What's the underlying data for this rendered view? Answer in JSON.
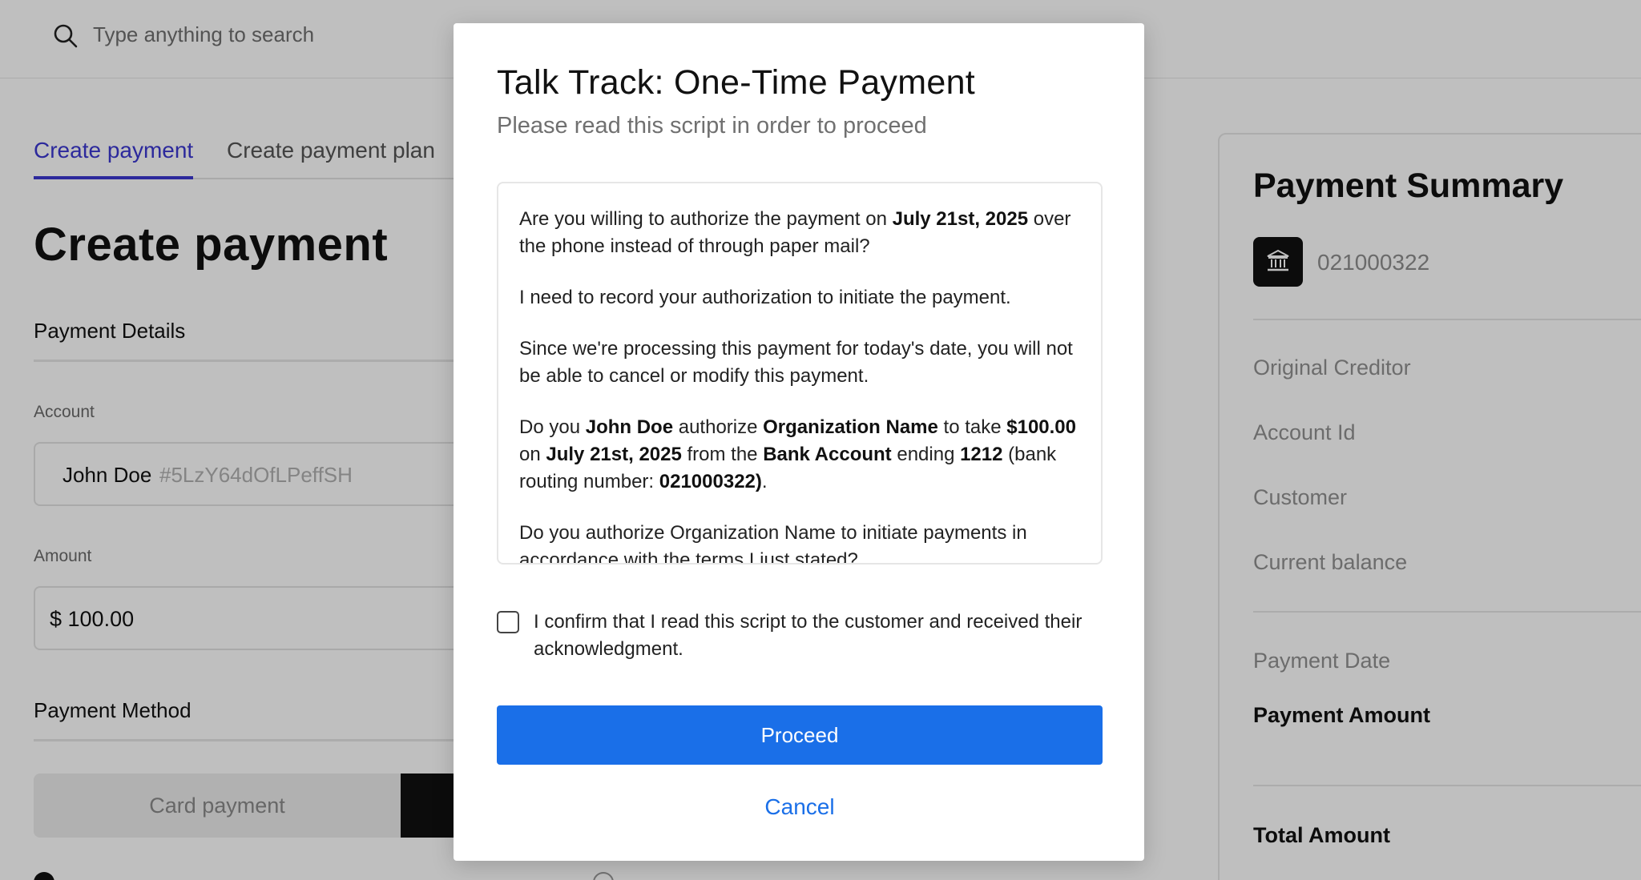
{
  "search": {
    "placeholder": "Type anything to search"
  },
  "tabs": [
    {
      "label": "Create payment",
      "active": true
    },
    {
      "label": "Create payment plan",
      "active": false
    }
  ],
  "page_title": "Create payment",
  "form": {
    "details_header": "Payment Details",
    "account_label": "Account",
    "account_name": "John Doe",
    "account_id": "#5LzY64dOfLPeffSH",
    "amount_label": "Amount",
    "amount_value": "$ 100.00",
    "method_header": "Payment Method",
    "method_card": "Card payment"
  },
  "summary": {
    "title": "Payment Summary",
    "routing_number": "021000322",
    "fields": [
      "Original Creditor",
      "Account Id",
      "Customer",
      "Current balance"
    ],
    "payment_date_label": "Payment Date",
    "payment_amount_label": "Payment Amount",
    "total_amount_label": "Total Amount"
  },
  "modal": {
    "title": "Talk Track: One-Time Payment",
    "subtitle": "Please read this script in order to proceed",
    "script": {
      "p1_a": "Are you willing to authorize the payment on ",
      "p1_date": "July 21st, 2025",
      "p1_b": " over the phone instead of through paper mail?",
      "p2": "I need to record your authorization to initiate the payment.",
      "p3": "Since we're processing this payment for today's date, you will not be able to cancel or modify this payment.",
      "p4_a": "Do you ",
      "p4_name": "John Doe",
      "p4_b": " authorize ",
      "p4_org": "Organization Name",
      "p4_c": " to take ",
      "p4_amount": "$100.00",
      "p4_d": " on ",
      "p4_date": "July 21st, 2025",
      "p4_e": " from the ",
      "p4_account": "Bank Account",
      "p4_f": " ending ",
      "p4_last4": "1212",
      "p4_g": " (bank routing number: ",
      "p4_routing": "021000322)",
      "p4_h": ".",
      "p5": "Do you authorize Organization Name to initiate payments in accordance with the terms I just stated?"
    },
    "confirm_label": "I confirm that I read this script to the customer and received their acknowledgment.",
    "confirm_checked": false,
    "proceed_label": "Proceed",
    "cancel_label": "Cancel"
  },
  "colors": {
    "accent_tab": "#3b37d0",
    "primary_button": "#1a6fe8",
    "overlay": "rgba(0,0,0,0.25)"
  }
}
